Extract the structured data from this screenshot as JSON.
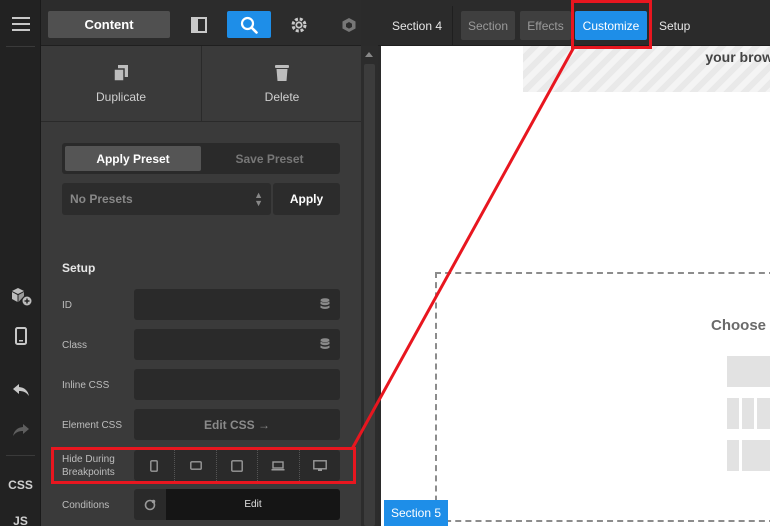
{
  "rail": {
    "css_label": "CSS",
    "js_label": "JS"
  },
  "panel": {
    "tabs": {
      "content_label": "Content"
    },
    "actions": {
      "duplicate_label": "Duplicate",
      "delete_label": "Delete"
    },
    "presets": {
      "apply_preset_label": "Apply Preset",
      "save_preset_label": "Save Preset",
      "select_value": "No Presets",
      "apply_label": "Apply"
    },
    "setup": {
      "heading": "Setup",
      "id_label": "ID",
      "class_label": "Class",
      "inline_css_label": "Inline CSS",
      "element_css_label": "Element CSS",
      "edit_css_label": "Edit CSS →",
      "hide_breakpoints_label_1": "Hide During",
      "hide_breakpoints_label_2": "Breakpoints",
      "conditions_label": "Conditions",
      "conditions_edit_label": "Edit"
    }
  },
  "topbar": {
    "crumb_section4": "Section 4",
    "tab_section": "Section",
    "tab_effects": "Effects",
    "tab_customize": "Customize",
    "tab_setup": "Setup"
  },
  "canvas": {
    "partial_text": "your brow",
    "choose_text": "Choose",
    "section5_label": "Section 5"
  },
  "colors": {
    "accent": "#1e8ee8",
    "annotation_red": "#e8161f",
    "panel_bg": "#3a3a3a"
  }
}
